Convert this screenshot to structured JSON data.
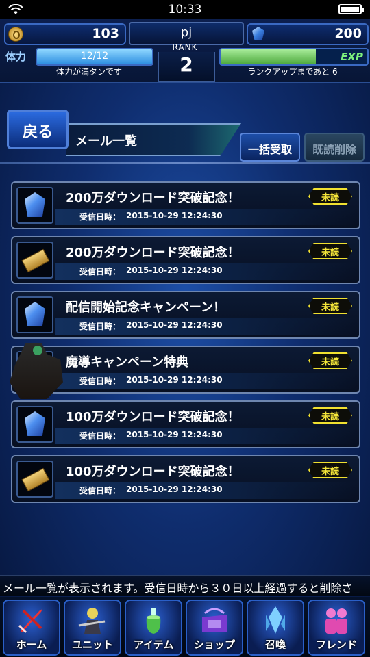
{
  "status_bar": {
    "time": "10:33"
  },
  "header": {
    "gil": "103",
    "gems": "200",
    "player_name": "pj",
    "rank_label": "RANK",
    "rank": "2",
    "stamina_label": "体力",
    "stamina_value": "12/12",
    "stamina_fill": 1.0,
    "stamina_note": "体力が満タンです",
    "exp_label": "EXP",
    "exp_fill": 0.65,
    "exp_note": "ランクアップまであと 6"
  },
  "toolbar": {
    "back_label": "戻る",
    "title": "メール一覧",
    "bulk_receive_label": "一括受取",
    "delete_read_label": "既読削除"
  },
  "mails": [
    {
      "icon": "gem-icon",
      "title": "200万ダウンロード突破記念！",
      "date_label": "受信日時：",
      "date": "2015-10-29  12:24:30",
      "badge": "未読"
    },
    {
      "icon": "ticket-icon",
      "title": "200万ダウンロード突破記念！",
      "date_label": "受信日時：",
      "date": "2015-10-29  12:24:30",
      "badge": "未読"
    },
    {
      "icon": "gem-icon",
      "title": "配信開始記念キャンペーン！",
      "date_label": "受信日時：",
      "date": "2015-10-29  12:24:30",
      "badge": "未読"
    },
    {
      "icon": "character-icon",
      "title": "魔導キャンペーン特典",
      "date_label": "受信日時：",
      "date": "2015-10-29  12:24:30",
      "badge": "未読"
    },
    {
      "icon": "gem-icon",
      "title": "100万ダウンロード突破記念！",
      "date_label": "受信日時：",
      "date": "2015-10-29  12:24:30",
      "badge": "未読"
    },
    {
      "icon": "ticket-icon",
      "title": "100万ダウンロード突破記念！",
      "date_label": "受信日時：",
      "date": "2015-10-29  12:24:30",
      "badge": "未読"
    }
  ],
  "marquee": "メール一覧が表示されます。受信日時から３０日以上経過すると削除さ",
  "nav": [
    {
      "label": "ホーム",
      "icon": "sword-icon"
    },
    {
      "label": "ユニット",
      "icon": "unit-icon"
    },
    {
      "label": "アイテム",
      "icon": "potion-icon"
    },
    {
      "label": "ショップ",
      "icon": "shop-icon"
    },
    {
      "label": "召喚",
      "icon": "crystal-icon"
    },
    {
      "label": "フレンド",
      "icon": "friend-icon"
    }
  ],
  "colors": {
    "accent": "#2a5fc8",
    "badge": "#f5e63a",
    "exp": "#7df07d",
    "stamina": "#2c8de0"
  }
}
